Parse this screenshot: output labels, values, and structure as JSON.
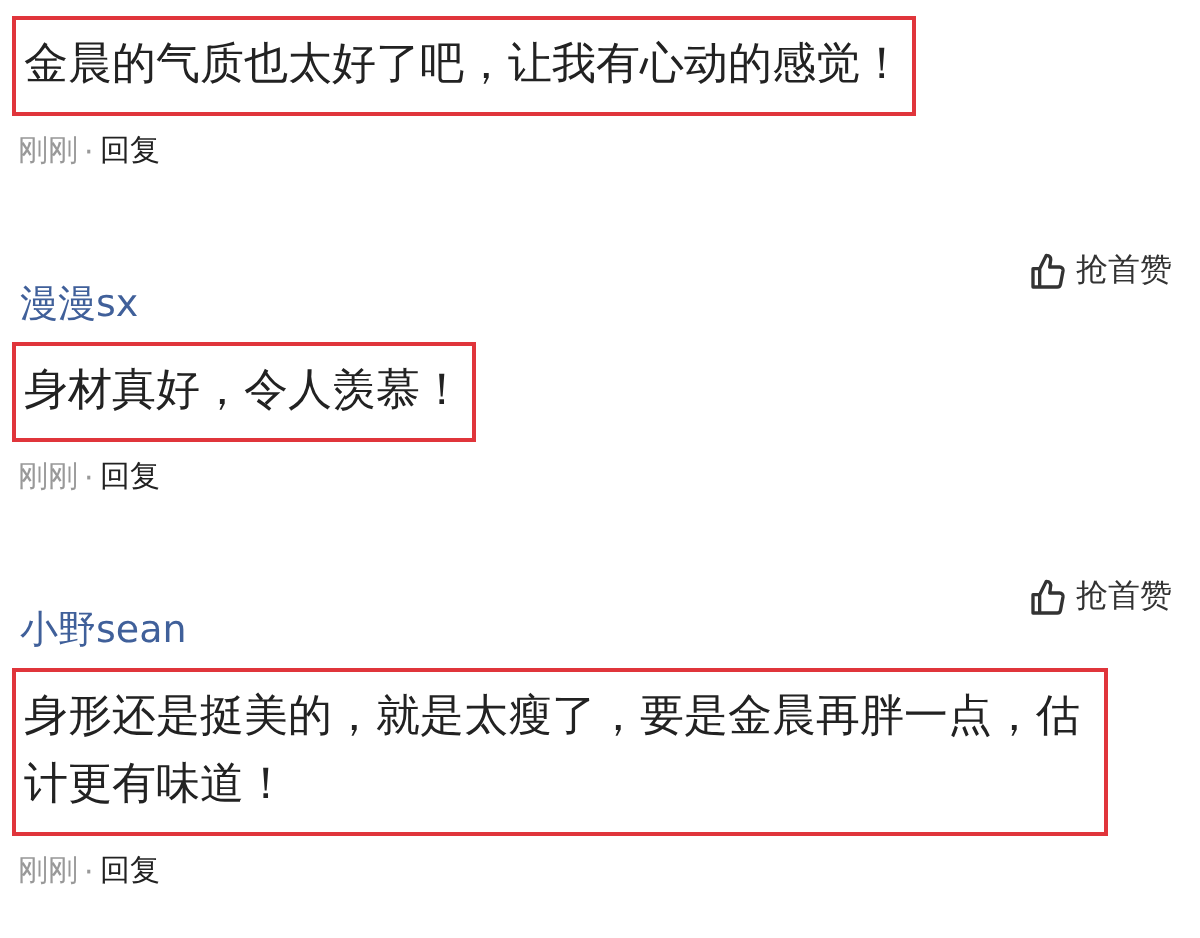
{
  "comments": [
    {
      "text": "金晨的气质也太好了吧，让我有心动的感觉！",
      "time": "刚刚",
      "separator": "·",
      "reply": "回复"
    },
    {
      "user": "漫漫sx",
      "like": "抢首赞",
      "text": "身材真好，令人羡慕！",
      "time": "刚刚",
      "separator": "·",
      "reply": "回复"
    },
    {
      "user": "小野sean",
      "like": "抢首赞",
      "text": "身形还是挺美的，就是太瘦了，要是金晨再胖一点，估计更有味道！",
      "time": "刚刚",
      "separator": "·",
      "reply": "回复"
    }
  ]
}
